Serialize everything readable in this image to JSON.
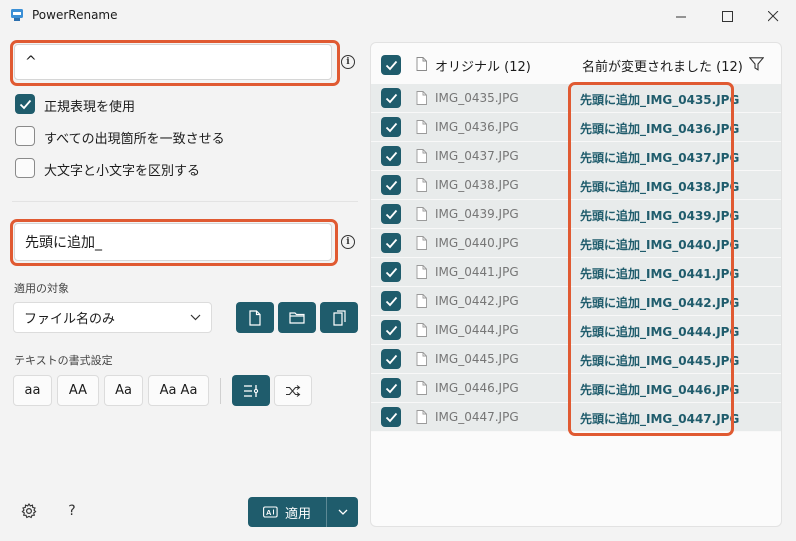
{
  "window": {
    "title": "PowerRename"
  },
  "search": {
    "value": "^"
  },
  "options": [
    {
      "label": "正規表現を使用",
      "checked": true
    },
    {
      "label": "すべての出現箇所を一致させる",
      "checked": false
    },
    {
      "label": "大文字と小文字を区別する",
      "checked": false
    }
  ],
  "replace": {
    "value": "先頭に追加_"
  },
  "apply_to": {
    "label": "適用の対象",
    "selected": "ファイル名のみ"
  },
  "text_format": {
    "label": "テキストの書式設定",
    "case_buttons": [
      "aa",
      "AA",
      "Aa",
      "Aa Aa"
    ]
  },
  "footer": {
    "apply_label": "適用"
  },
  "list": {
    "original_header": "オリジナル (12)",
    "renamed_header": "名前が変更されました (12)",
    "rows": [
      {
        "original": "IMG_0435.JPG",
        "renamed": "先頭に追加_IMG_0435.JPG"
      },
      {
        "original": "IMG_0436.JPG",
        "renamed": "先頭に追加_IMG_0436.JPG"
      },
      {
        "original": "IMG_0437.JPG",
        "renamed": "先頭に追加_IMG_0437.JPG"
      },
      {
        "original": "IMG_0438.JPG",
        "renamed": "先頭に追加_IMG_0438.JPG"
      },
      {
        "original": "IMG_0439.JPG",
        "renamed": "先頭に追加_IMG_0439.JPG"
      },
      {
        "original": "IMG_0440.JPG",
        "renamed": "先頭に追加_IMG_0440.JPG"
      },
      {
        "original": "IMG_0441.JPG",
        "renamed": "先頭に追加_IMG_0441.JPG"
      },
      {
        "original": "IMG_0442.JPG",
        "renamed": "先頭に追加_IMG_0442.JPG"
      },
      {
        "original": "IMG_0444.JPG",
        "renamed": "先頭に追加_IMG_0444.JPG"
      },
      {
        "original": "IMG_0445.JPG",
        "renamed": "先頭に追加_IMG_0445.JPG"
      },
      {
        "original": "IMG_0446.JPG",
        "renamed": "先頭に追加_IMG_0446.JPG"
      },
      {
        "original": "IMG_0447.JPG",
        "renamed": "先頭に追加_IMG_0447.JPG"
      }
    ]
  },
  "icons": {
    "search_info": "info-icon",
    "replace_info": "info-icon",
    "filter": "filter-icon",
    "settings": "gear-icon",
    "help": "question-icon"
  },
  "colors": {
    "accent": "#1f5c6c",
    "highlight": "#e05a32",
    "row_bg": "#e8ebeb"
  }
}
